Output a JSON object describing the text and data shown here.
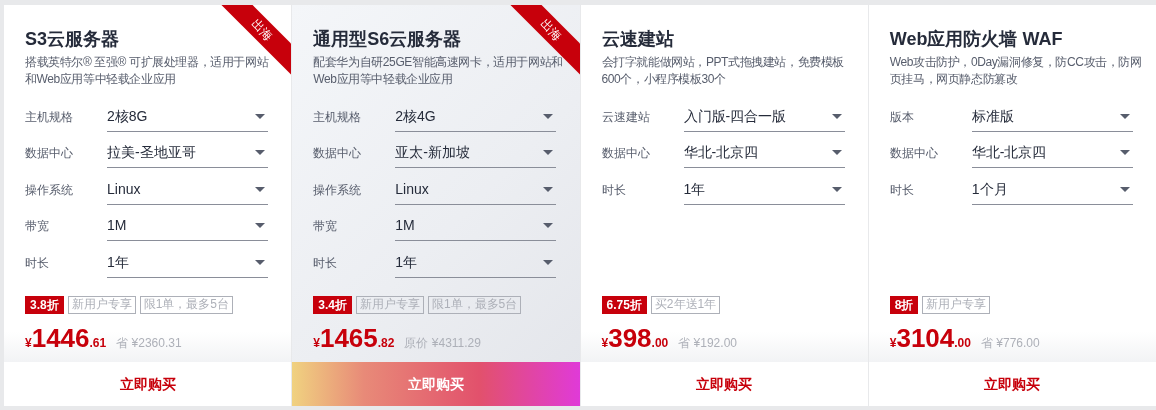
{
  "products": [
    {
      "title": "S3云服务器",
      "ribbon": "出海",
      "highlighted": false,
      "description": "搭载英特尔® 至强® 可扩展处理器，适用于网站和Web应用等中轻载企业应用",
      "options": [
        {
          "label": "主机规格",
          "value": "2核8G"
        },
        {
          "label": "数据中心",
          "value": "拉美-圣地亚哥"
        },
        {
          "label": "操作系统",
          "value": "Linux"
        },
        {
          "label": "带宽",
          "value": "1M"
        },
        {
          "label": "时长",
          "value": "1年"
        }
      ],
      "tags": [
        {
          "kind": "discount",
          "text": "3.8折"
        },
        {
          "kind": "plain",
          "text": "新用户专享"
        },
        {
          "kind": "plain",
          "text": "限1单，最多5台"
        }
      ],
      "price": {
        "currency": "¥",
        "integer": "1446",
        "decimal": ".61",
        "note": "省 ¥2360.31"
      },
      "button": "立即购买"
    },
    {
      "title": "通用型S6云服务器",
      "ribbon": "出海",
      "highlighted": true,
      "description": "配套华为自研25GE智能高速网卡，适用于网站和Web应用等中轻载企业应用",
      "options": [
        {
          "label": "主机规格",
          "value": "2核4G"
        },
        {
          "label": "数据中心",
          "value": "亚太-新加坡"
        },
        {
          "label": "操作系统",
          "value": "Linux"
        },
        {
          "label": "带宽",
          "value": "1M"
        },
        {
          "label": "时长",
          "value": "1年"
        }
      ],
      "tags": [
        {
          "kind": "discount",
          "text": "3.4折"
        },
        {
          "kind": "plain",
          "text": "新用户专享"
        },
        {
          "kind": "plain",
          "text": "限1单，最多5台"
        }
      ],
      "price": {
        "currency": "¥",
        "integer": "1465",
        "decimal": ".82",
        "note": "原价 ¥4311.29"
      },
      "button": "立即购买"
    },
    {
      "title": "云速建站",
      "highlighted": false,
      "description": "会打字就能做网站，PPT式拖拽建站，免费模板600个，小程序模板30个",
      "options": [
        {
          "label": "云速建站",
          "value": "入门版-四合一版"
        },
        {
          "label": "数据中心",
          "value": "华北-北京四"
        },
        {
          "label": "时长",
          "value": "1年"
        }
      ],
      "tags": [
        {
          "kind": "discount",
          "text": "6.75折"
        },
        {
          "kind": "plain",
          "text": "买2年送1年"
        }
      ],
      "price": {
        "currency": "¥",
        "integer": "398",
        "decimal": ".00",
        "note": "省 ¥192.00"
      },
      "button": "立即购买"
    },
    {
      "title": "Web应用防火墙 WAF",
      "highlighted": false,
      "description": "Web攻击防护，0Day漏洞修复，防CC攻击，防网页挂马，网页静态防篡改",
      "options": [
        {
          "label": "版本",
          "value": "标准版"
        },
        {
          "label": "数据中心",
          "value": "华北-北京四"
        },
        {
          "label": "时长",
          "value": "1个月"
        }
      ],
      "tags": [
        {
          "kind": "discount",
          "text": "8折"
        },
        {
          "kind": "plain",
          "text": "新用户专享"
        }
      ],
      "price": {
        "currency": "¥",
        "integer": "3104",
        "decimal": ".00",
        "note": "省 ¥776.00"
      },
      "button": "立即购买"
    }
  ]
}
